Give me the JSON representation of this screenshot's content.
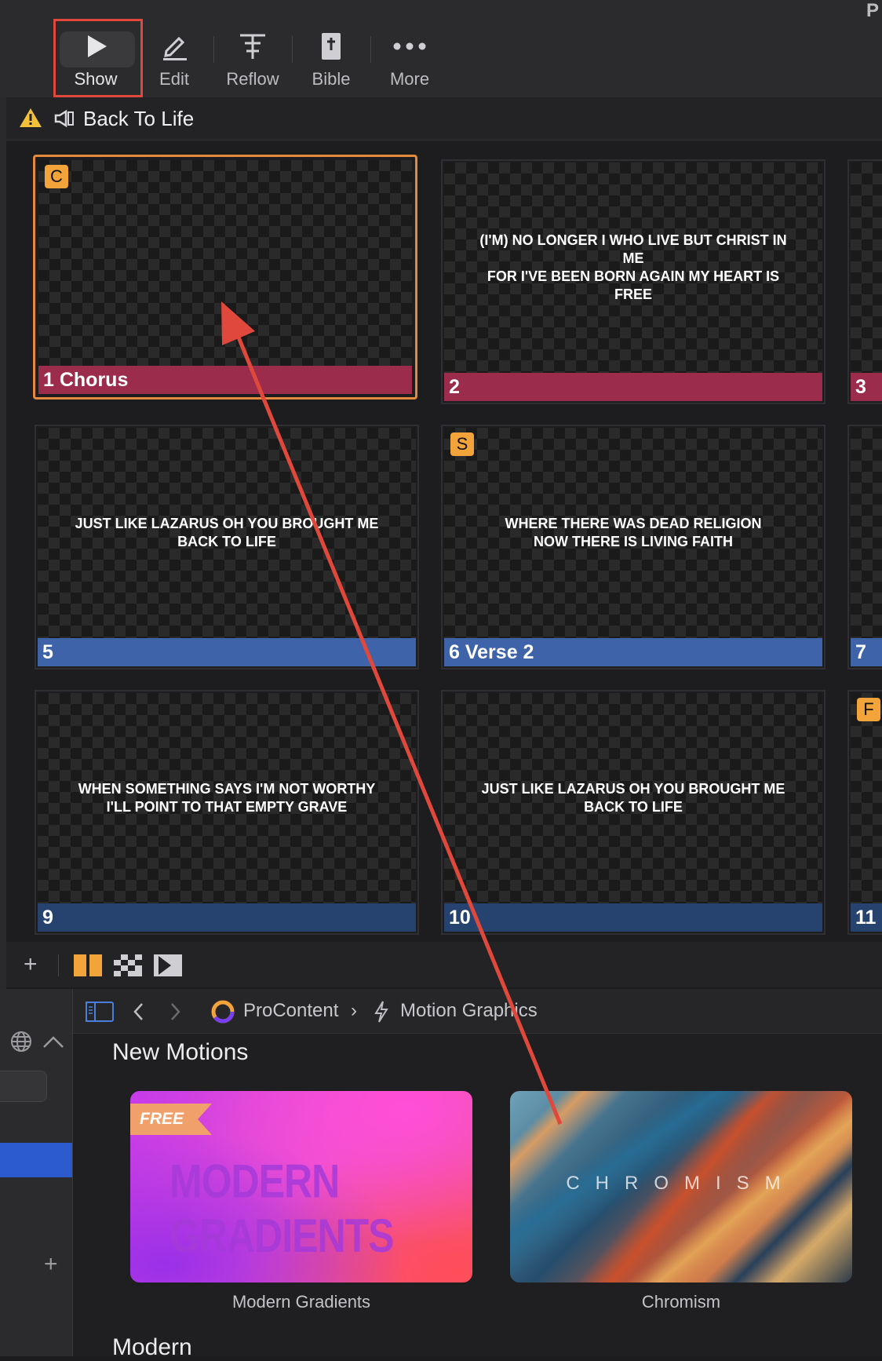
{
  "toolbar": {
    "corner_letter": "P",
    "items": [
      {
        "label": "Show",
        "icon": "play-icon",
        "selected": true
      },
      {
        "label": "Edit",
        "icon": "pencil-icon"
      },
      {
        "label": "Reflow",
        "icon": "reflow-icon"
      },
      {
        "label": "Bible",
        "icon": "bible-icon"
      },
      {
        "label": "More",
        "icon": "more-dots-icon"
      }
    ]
  },
  "presentation": {
    "title": "Back To Life",
    "warning_icon": "warning-icon",
    "doc_icon": "speaker-doc-icon"
  },
  "slides": [
    {
      "number": "1",
      "group": "Chorus",
      "badge": "C",
      "lyric": "",
      "color": "#9c2c4b",
      "selected": true
    },
    {
      "number": "2",
      "group": "",
      "badge": "",
      "lyric": "(I'M) NO LONGER I WHO LIVE BUT CHRIST IN ME\nFOR I'VE BEEN BORN AGAIN MY HEART IS FREE",
      "color": "#9c2c4b"
    },
    {
      "number": "3",
      "group": "",
      "badge": "",
      "lyric": "",
      "color": "#9c2c4b"
    },
    {
      "number": "5",
      "group": "",
      "badge": "",
      "lyric": "JUST LIKE LAZARUS OH YOU BROUGHT ME\nBACK TO LIFE",
      "color": "#3e63a8"
    },
    {
      "number": "6",
      "group": "Verse 2",
      "badge": "S",
      "lyric": "WHERE THERE WAS DEAD RELIGION\nNOW THERE IS LIVING FAITH",
      "color": "#3e63a8"
    },
    {
      "number": "7",
      "group": "",
      "badge": "",
      "lyric": "",
      "color": "#3e63a8"
    },
    {
      "number": "9",
      "group": "",
      "badge": "",
      "lyric": "WHEN SOMETHING SAYS I'M NOT WORTHY\nI'LL POINT TO THAT EMPTY GRAVE",
      "color": "#26426f"
    },
    {
      "number": "10",
      "group": "",
      "badge": "",
      "lyric": "JUST LIKE LAZARUS OH YOU BROUGHT ME\nBACK TO LIFE",
      "color": "#26426f"
    },
    {
      "number": "11",
      "group": "",
      "badge": "F",
      "lyric": "",
      "color": "#26426f"
    }
  ],
  "slide_toolbar": {
    "add_label": "+",
    "icons": [
      "add-icon",
      "columns-icon",
      "checker-icon",
      "next-slide-icon"
    ]
  },
  "library": {
    "breadcrumb": {
      "source": "ProContent",
      "separator": "›",
      "category": "Motion Graphics"
    },
    "section_title": "New Motions",
    "next_section": "Modern",
    "cards": [
      {
        "title": "Modern Gradients",
        "ribbon": "FREE",
        "art_text": "MODERN GRADIENTS"
      },
      {
        "title": "Chromism",
        "art_text": "CHROMISM"
      }
    ]
  },
  "annotation": {
    "arrow_color": "#e0483b"
  }
}
